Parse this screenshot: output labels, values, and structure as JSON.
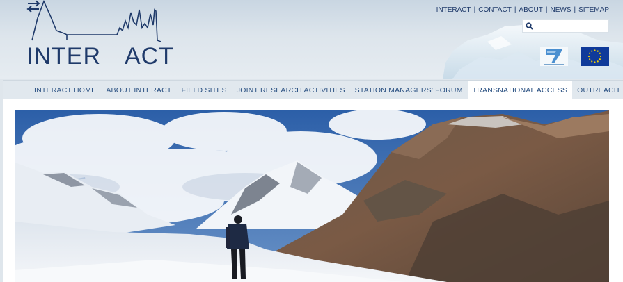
{
  "logo": {
    "text_left": "INTER",
    "text_right": "ACT"
  },
  "top_links": [
    "INTERACT",
    "CONTACT",
    "ABOUT",
    "NEWS",
    "SITEMAP"
  ],
  "search": {
    "placeholder": ""
  },
  "nav": [
    "INTERACT HOME",
    "ABOUT INTERACT",
    "FIELD SITES",
    "JOINT RESEARCH ACTIVITIES",
    "STATION MANAGERS' FORUM",
    "TRANSNATIONAL ACCESS",
    "OUTREACH"
  ],
  "nav_active_index": 5,
  "colors": {
    "brand_navy": "#1f3a6a",
    "nav_text": "#2c5283",
    "eu_blue": "#0f3a9a",
    "eu_star": "#f5d000"
  },
  "icons": [
    "search-icon",
    "fp7-logo",
    "eu-flag"
  ]
}
